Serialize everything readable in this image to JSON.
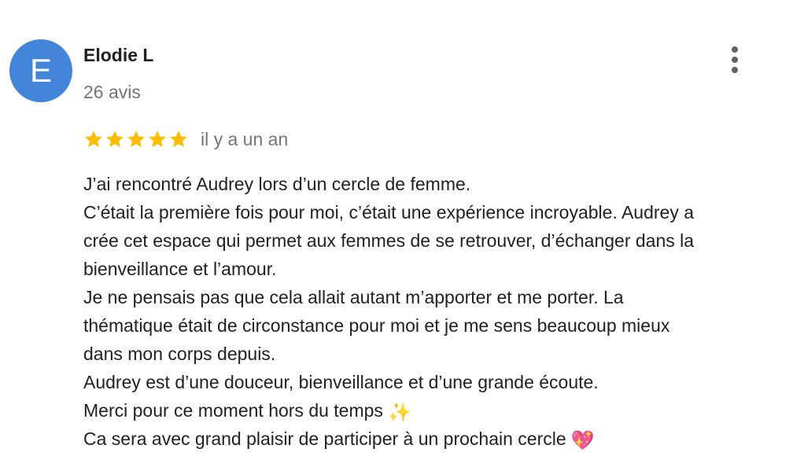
{
  "review": {
    "author": {
      "initial": "E",
      "name": "Elodie L",
      "review_count": "26 avis",
      "avatar_color": "#4285d9"
    },
    "menu_icon": "more-vert-icon",
    "rating": {
      "stars": 5,
      "max_stars": 5,
      "star_color": "#fbbc04",
      "relative_date": "il y a un an"
    },
    "text_lines": [
      {
        "text": "J’ai rencontré Audrey lors d’un cercle de femme.",
        "emoji": ""
      },
      {
        "text": "C’était la première fois pour moi, c’était une expérience incroyable. Audrey a",
        "emoji": ""
      },
      {
        "text": "crée cet espace qui permet aux femmes de se retrouver, d’échanger dans la",
        "emoji": ""
      },
      {
        "text": "bienveillance et l’amour.",
        "emoji": ""
      },
      {
        "text": "Je ne pensais pas que cela allait autant m’apporter et me porter. La",
        "emoji": ""
      },
      {
        "text": "thématique était de circonstance pour moi et je me sens beaucoup mieux",
        "emoji": ""
      },
      {
        "text": "dans mon corps depuis.",
        "emoji": ""
      },
      {
        "text": "Audrey est d’une douceur, bienveillance et d’une grande écoute.",
        "emoji": ""
      },
      {
        "text": "Merci pour ce moment hors du temps",
        "emoji": "✨"
      },
      {
        "text": "Ca sera avec grand plaisir de participer à un prochain cercle",
        "emoji": "💖"
      }
    ]
  }
}
